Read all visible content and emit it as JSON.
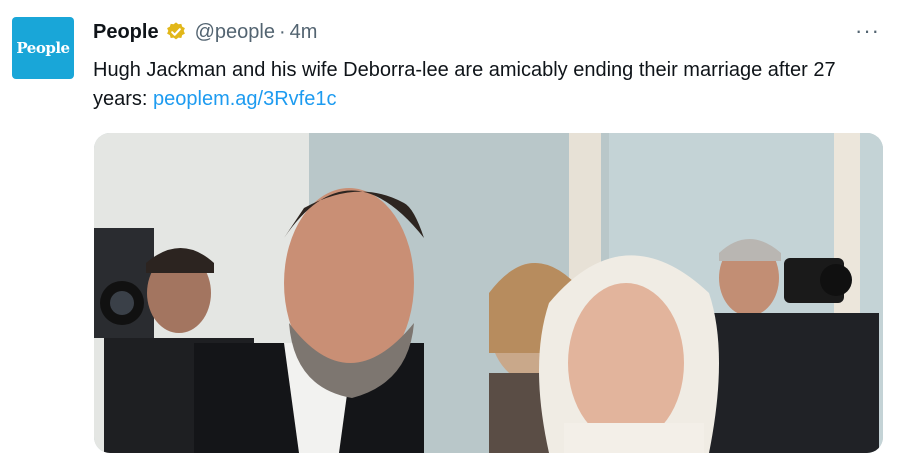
{
  "avatar": {
    "logo_text": "People"
  },
  "header": {
    "name": "People",
    "handle": "@people",
    "separator": "·",
    "time": "4m",
    "more": "···"
  },
  "tweet": {
    "text": "Hugh Jackman and his wife Deborra-lee are amicably ending their marriage after 27 years: ",
    "link": "peoplem.ag/3Rvfe1c"
  },
  "colors": {
    "brand": "#19a6d8",
    "link": "#1d9bf0",
    "verified_badge": "#e2b719",
    "secondary_text": "#536471"
  },
  "icons": {
    "verified": "verified-badge-icon",
    "more": "more-options-icon"
  }
}
